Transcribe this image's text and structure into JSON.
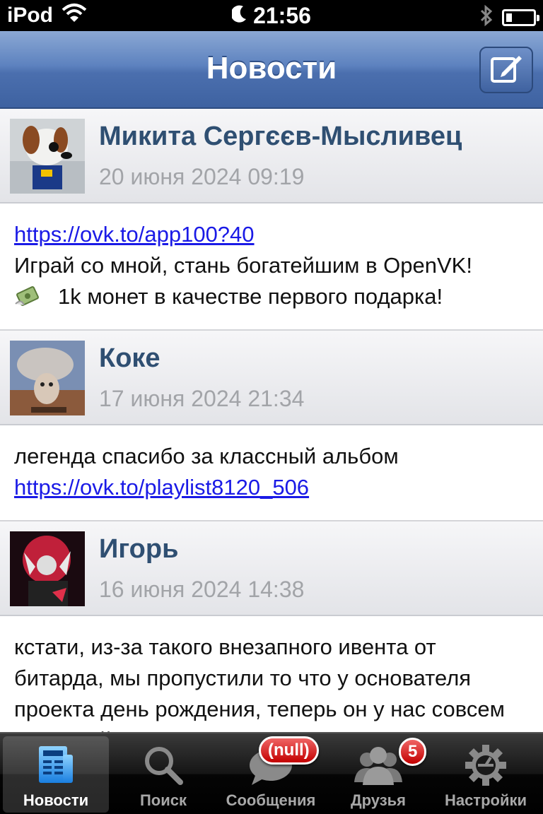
{
  "status_bar": {
    "device": "iPod",
    "time": "21:56",
    "icons": [
      "wifi-icon",
      "moon-icon",
      "bluetooth-icon",
      "battery-icon"
    ]
  },
  "nav": {
    "title": "Новости",
    "compose_icon": "compose-icon"
  },
  "posts": [
    {
      "author": "Микита Сергєєв-Мысливец",
      "date": "20 июня 2024 09:19",
      "link": "https://ovk.to/app100?40",
      "text": "Играй со мной, стань богатейшим в OpenVK!",
      "emoji_icon": "money-with-wings-icon",
      "emoji_text": "1k монет в качестве первого подарка!"
    },
    {
      "author": "Коке",
      "date": "17 июня 2024 21:34",
      "text": "легенда спасибо за классный альбом",
      "link": "https://ovk.to/playlist8120_506"
    },
    {
      "author": "Игорь",
      "date": "16 июня 2024 14:38",
      "text": "кстати, из-за такого внезапного ивента от битарда, мы пропустили то что у основателя проекта день рождения, теперь он у нас совсем взрослый"
    }
  ],
  "tabs": [
    {
      "label": "Новости",
      "icon": "news-icon",
      "active": true
    },
    {
      "label": "Поиск",
      "icon": "search-icon"
    },
    {
      "label": "Сообщения",
      "icon": "messages-icon",
      "badge": "(null)"
    },
    {
      "label": "Друзья",
      "icon": "friends-icon",
      "badge": "5"
    },
    {
      "label": "Настройки",
      "icon": "gear-icon"
    }
  ],
  "colors": {
    "nav_blue": "#4b6fae",
    "author": "#2f4f72",
    "link": "#1a1ae6",
    "badge_red": "#c30000"
  }
}
